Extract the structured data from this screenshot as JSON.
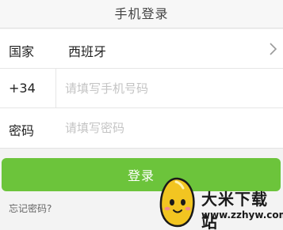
{
  "header": {
    "title": "手机登录"
  },
  "form": {
    "country": {
      "label": "国家",
      "value": "西班牙"
    },
    "phone": {
      "code": "+34",
      "placeholder": "请填写手机号码"
    },
    "password": {
      "label": "密码",
      "placeholder": "请填写密码"
    }
  },
  "login_button": {
    "label": "登录",
    "color": "#6cc43b"
  },
  "forgot_link": {
    "label": "忘记密码?"
  },
  "watermark": {
    "name": "大米下载站",
    "url": "www.zzhyw.com"
  }
}
